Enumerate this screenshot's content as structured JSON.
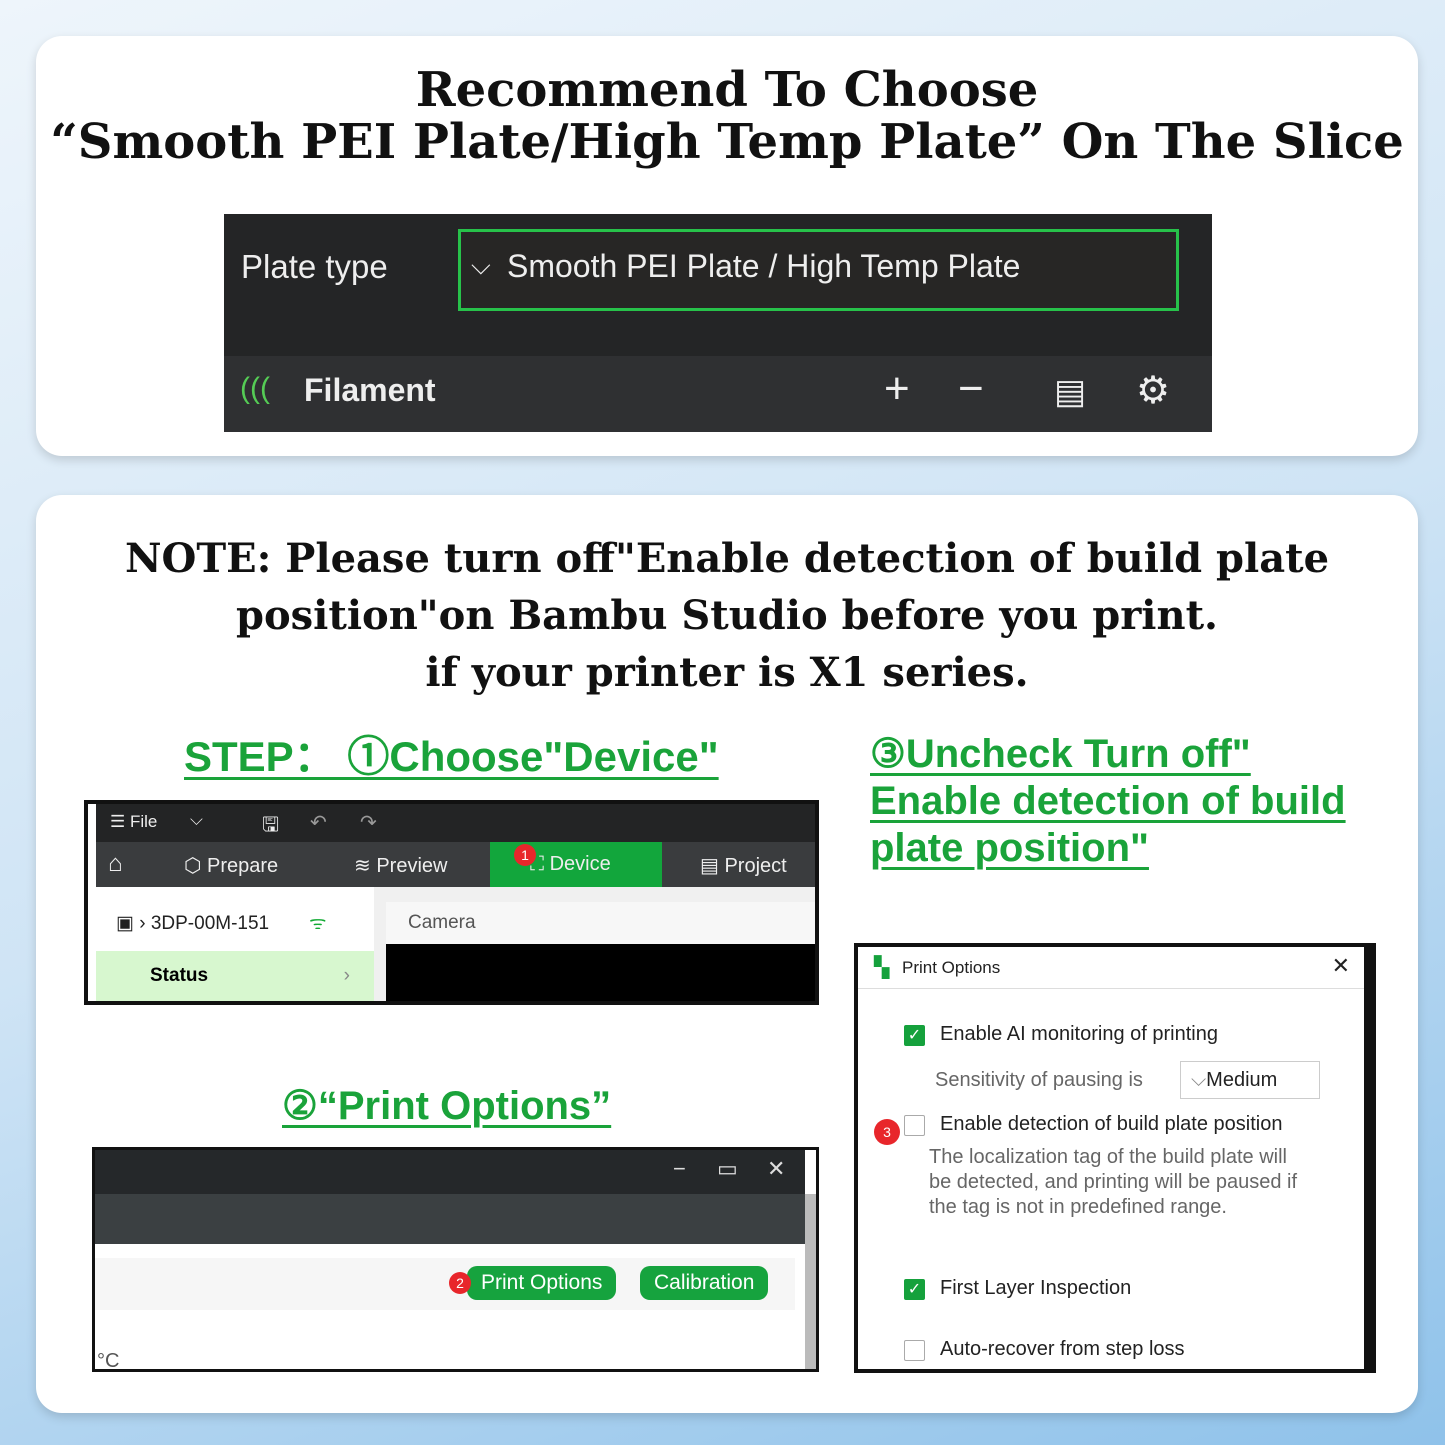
{
  "top": {
    "title_line1": "Recommend To Choose",
    "title_line2": "“Smooth PEI Plate/High Temp Plate”  On The Slice",
    "plate_type_label": "Plate type",
    "plate_type_value": "Smooth PEI Plate / High Temp Plate",
    "filament_label": "Filament"
  },
  "note": {
    "line1": "NOTE: Please turn off\"Enable detection of build plate",
    "line2": "position\"on Bambu Studio before you print.",
    "line3": "if your printer is X1 series."
  },
  "steps": {
    "step1": "STEP：  ①Choose\"Device\"",
    "step2": "②“Print Options”",
    "step3_line1": "③Uncheck Turn off\"",
    "step3_line2": "Enable detection of build",
    "step3_line3": "plate position\""
  },
  "device_ui": {
    "file": "File",
    "tabs": [
      "Prepare",
      "Preview",
      "Device",
      "Project"
    ],
    "badge": "1",
    "printer": "3DP-00M-151",
    "camera": "Camera",
    "status": "Status"
  },
  "options_ui": {
    "badge": "2",
    "print_options": "Print Options",
    "calibration": "Calibration",
    "unit": "°C"
  },
  "dialog": {
    "title": "Print Options",
    "badge": "3",
    "items": [
      {
        "label": "Enable AI monitoring of printing",
        "checked": true
      },
      {
        "label": "Enable detection of build plate position",
        "checked": false
      },
      {
        "label": "First Layer Inspection",
        "checked": true
      },
      {
        "label": "Auto-recover from step loss",
        "checked": false
      }
    ],
    "sensitivity_label": "Sensitivity of pausing is",
    "sensitivity_value": "Medium",
    "description": "The localization tag of the build plate will be detected, and printing will be paused if the tag is not in predefined range."
  },
  "colors": {
    "accent": "#16a33e",
    "badge": "#e8262b"
  }
}
